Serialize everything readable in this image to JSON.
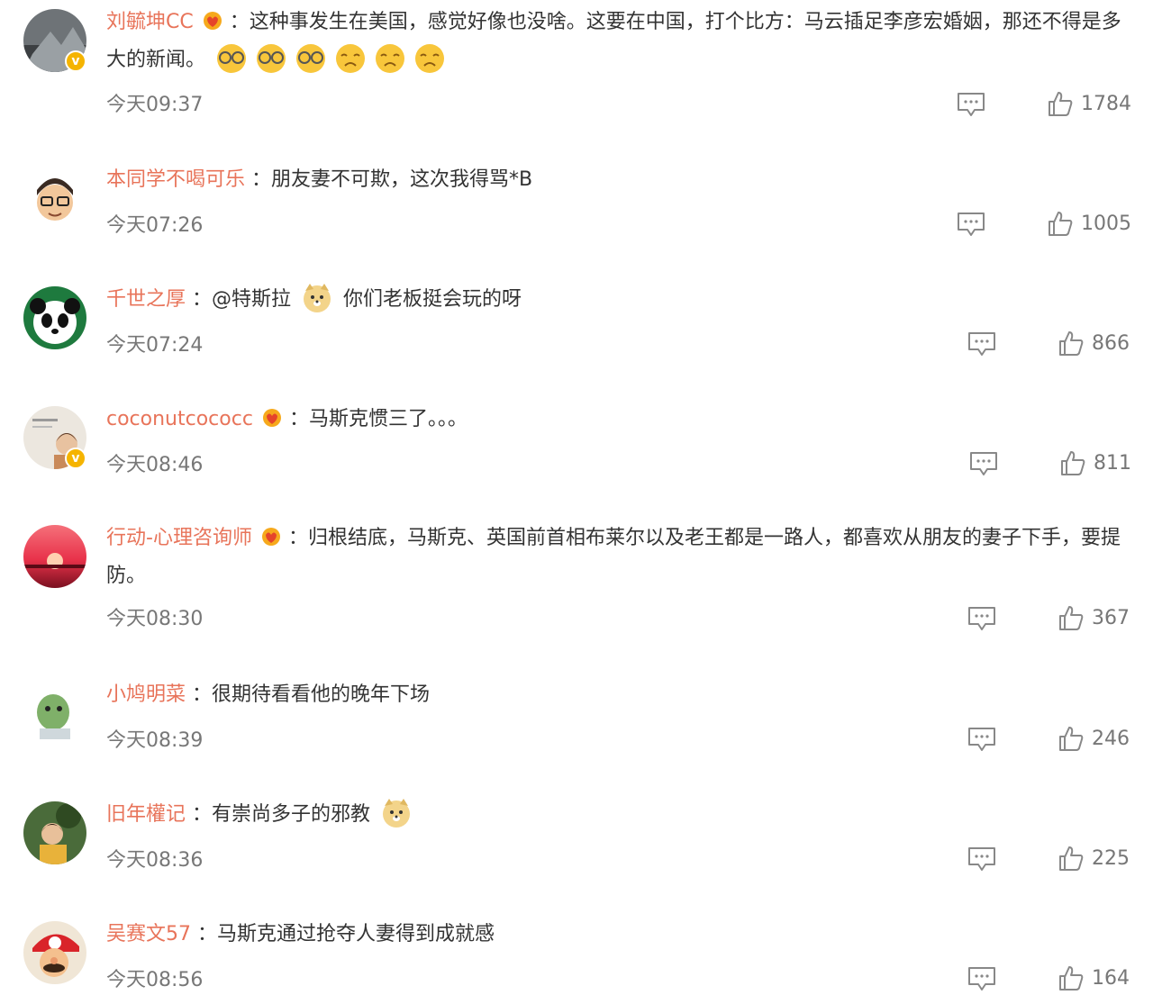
{
  "comments": [
    {
      "username": "刘毓坤CC",
      "text_before": "：这种事发生在美国，感觉好像也没啥。这要在中国，打个比方：马云插足李彦宏婚姻，那还不得是多大的新闻。",
      "time": "今天09:37",
      "likes": "1784",
      "verified": true,
      "emojis": [
        "dizzy-face-emoji",
        "dizzy-face-emoji",
        "dizzy-face-emoji",
        "sad-face-emoji",
        "sad-face-emoji",
        "sad-face-emoji"
      ]
    },
    {
      "username": "本同学不喝可乐",
      "text_before": "：朋友妻不可欺，这次我得骂*B",
      "time": "今天07:26",
      "likes": "1005"
    },
    {
      "username": "千世之厚",
      "text_before": "：@特斯拉",
      "text_after": "你们老板挺会玩的呀",
      "time": "今天07:24",
      "likes": "866",
      "emojis": [
        "doge-emoji"
      ]
    },
    {
      "username": "coconutcococc",
      "text_before": "：马斯克惯三了。。。",
      "time": "今天08:46",
      "likes": "811",
      "verified": true
    },
    {
      "username": "行动-心理咨询师",
      "text_before": "：归根结底，马斯克、英国前首相布莱尔以及老王都是一路人，都喜欢从朋友的妻子下手，要提防。",
      "time": "今天08:30",
      "likes": "367"
    },
    {
      "username": "小鸠明菜",
      "text_before": "：很期待看看他的晚年下场",
      "time": "今天08:39",
      "likes": "246"
    },
    {
      "username": "旧年權记",
      "text_before": "：有崇尚多子的邪教",
      "time": "今天08:36",
      "likes": "225",
      "emojis": [
        "doge-emoji"
      ]
    },
    {
      "username": "吴赛文57",
      "text_before": "：马斯克通过抢夺人妻得到成就感",
      "time": "今天08:56",
      "likes": "164"
    }
  ],
  "colors": {
    "username": "#e8745a",
    "text": "#333333",
    "meta": "#777777",
    "icon": "#888888",
    "verified_badge": "#f5b400"
  },
  "icons": {
    "reply": "comment-bubble-icon",
    "like": "thumbs-up-icon",
    "vip": "vip-heart-badge-icon"
  }
}
